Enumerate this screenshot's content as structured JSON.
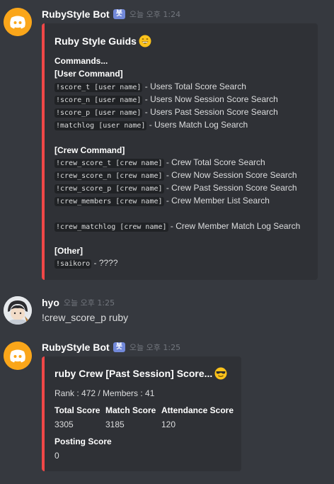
{
  "messages": [
    {
      "username": "RubyStyle Bot",
      "bot_tag": "봇",
      "timestamp": "오늘 오후 1:24",
      "embed": {
        "title": "Ruby Style Guids",
        "title_emoji": "grinning-face-emoji",
        "lines": [
          {
            "type": "bold",
            "text": "Commands..."
          },
          {
            "type": "bold",
            "text": "[User Command]"
          },
          {
            "type": "cmd",
            "code": "!score_t [user name]",
            "text": " - Users Total Score Search"
          },
          {
            "type": "cmd",
            "code": "!score_n [user name]",
            "text": " - Users Now Session Score Search"
          },
          {
            "type": "cmd",
            "code": "!score_p [user name]",
            "text": " - Users Past Session Score Search"
          },
          {
            "type": "cmd",
            "code": "!matchlog [user name]",
            "text": " - Users Match Log Search"
          },
          {
            "type": "bold",
            "text": "[Crew Command]"
          },
          {
            "type": "cmd",
            "code": "!crew_score_t [crew name]",
            "text": " - Crew Total Score Search"
          },
          {
            "type": "cmd",
            "code": "!crew_score_n [crew name]",
            "text": " - Crew Now Session Score Search"
          },
          {
            "type": "cmd",
            "code": "!crew_score_p [crew name]",
            "text": " - Crew Past Session Score Search"
          },
          {
            "type": "cmd",
            "code": "!crew_members [crew name]",
            "text": " - Crew Member List Search"
          },
          {
            "type": "cmd",
            "code": "!crew_matchlog [crew name]",
            "text": " - Crew Member Match Log Search"
          },
          {
            "type": "bold",
            "text": "[Other]"
          },
          {
            "type": "cmd",
            "code": "!saikoro",
            "text": " - ????"
          }
        ]
      }
    },
    {
      "username": "hyo",
      "timestamp": "오늘 오후 1:25",
      "text": "!crew_score_p ruby"
    },
    {
      "username": "RubyStyle Bot",
      "bot_tag": "봇",
      "timestamp": "오늘 오후 1:25",
      "embed": {
        "title": "ruby Crew [Past Session] Score...",
        "title_emoji": "smiling-face-with-sunglasses-emoji",
        "description": "Rank : 472 / Members : 41",
        "fields": [
          {
            "name": "Total Score",
            "value": "3305"
          },
          {
            "name": "Match Score",
            "value": "3185"
          },
          {
            "name": "Attendance Score",
            "value": "120"
          },
          {
            "name": "Posting Score",
            "value": "0"
          }
        ]
      }
    }
  ],
  "colors": {
    "background": "#36393f",
    "embed_background": "#2f3136",
    "embed_accent": "#f04747",
    "bot_tag": "#7289da",
    "bot_avatar": "#faa61a"
  }
}
